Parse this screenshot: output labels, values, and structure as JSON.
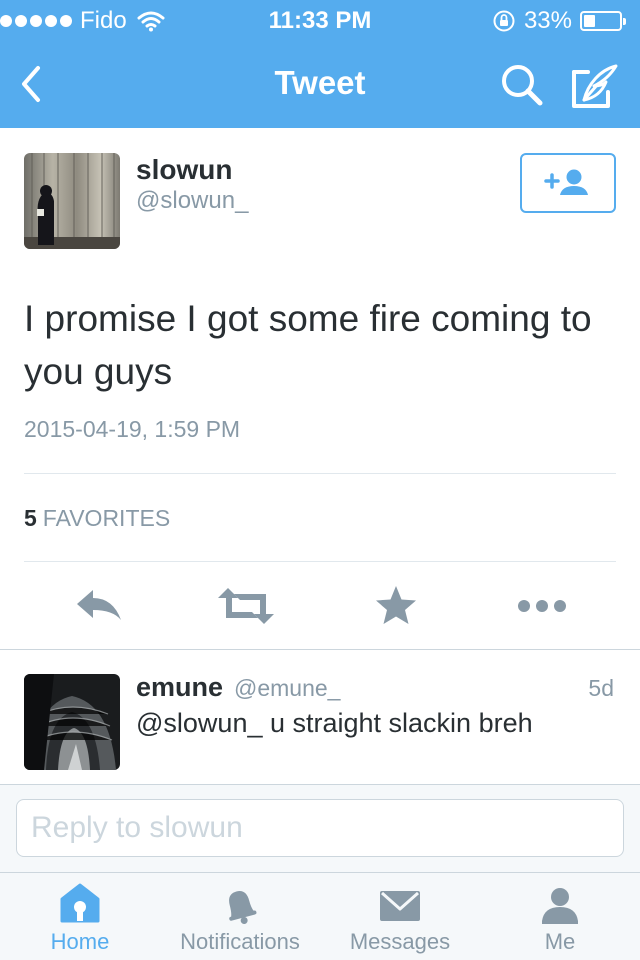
{
  "status_bar": {
    "carrier": "Fido",
    "time": "11:33 PM",
    "battery_percent": "33%",
    "battery_level": 0.33
  },
  "nav": {
    "title": "Tweet",
    "icons": [
      "back-chevron-icon",
      "search-icon",
      "compose-tweet-icon"
    ]
  },
  "tweet": {
    "author_name": "slowun",
    "author_handle": "@slowun_",
    "text": "I promise I got some fire coming to you guys",
    "timestamp": "2015-04-19, 1:59 PM",
    "favorites_count": "5",
    "favorites_label": "FAVORITES",
    "follow_icon": "add-user-icon",
    "actions": [
      "reply-icon",
      "retweet-icon",
      "favorite-star-icon",
      "more-icon"
    ]
  },
  "reply": {
    "name": "emune",
    "handle": "@emune_",
    "age": "5d",
    "text": "@slowun_ u straight slackin breh"
  },
  "compose": {
    "placeholder": "Reply to slowun"
  },
  "tabs": [
    {
      "label": "Home",
      "icon": "home-icon",
      "active": true
    },
    {
      "label": "Notifications",
      "icon": "notifications-bell-icon",
      "active": false
    },
    {
      "label": "Messages",
      "icon": "messages-envelope-icon",
      "active": false
    },
    {
      "label": "Me",
      "icon": "profile-icon",
      "active": false
    }
  ],
  "colors": {
    "brand": "#55acee",
    "text_primary": "#292f33",
    "text_secondary": "#8899a6",
    "divider": "#e1e8ed",
    "icon_gray": "#8899a6"
  }
}
